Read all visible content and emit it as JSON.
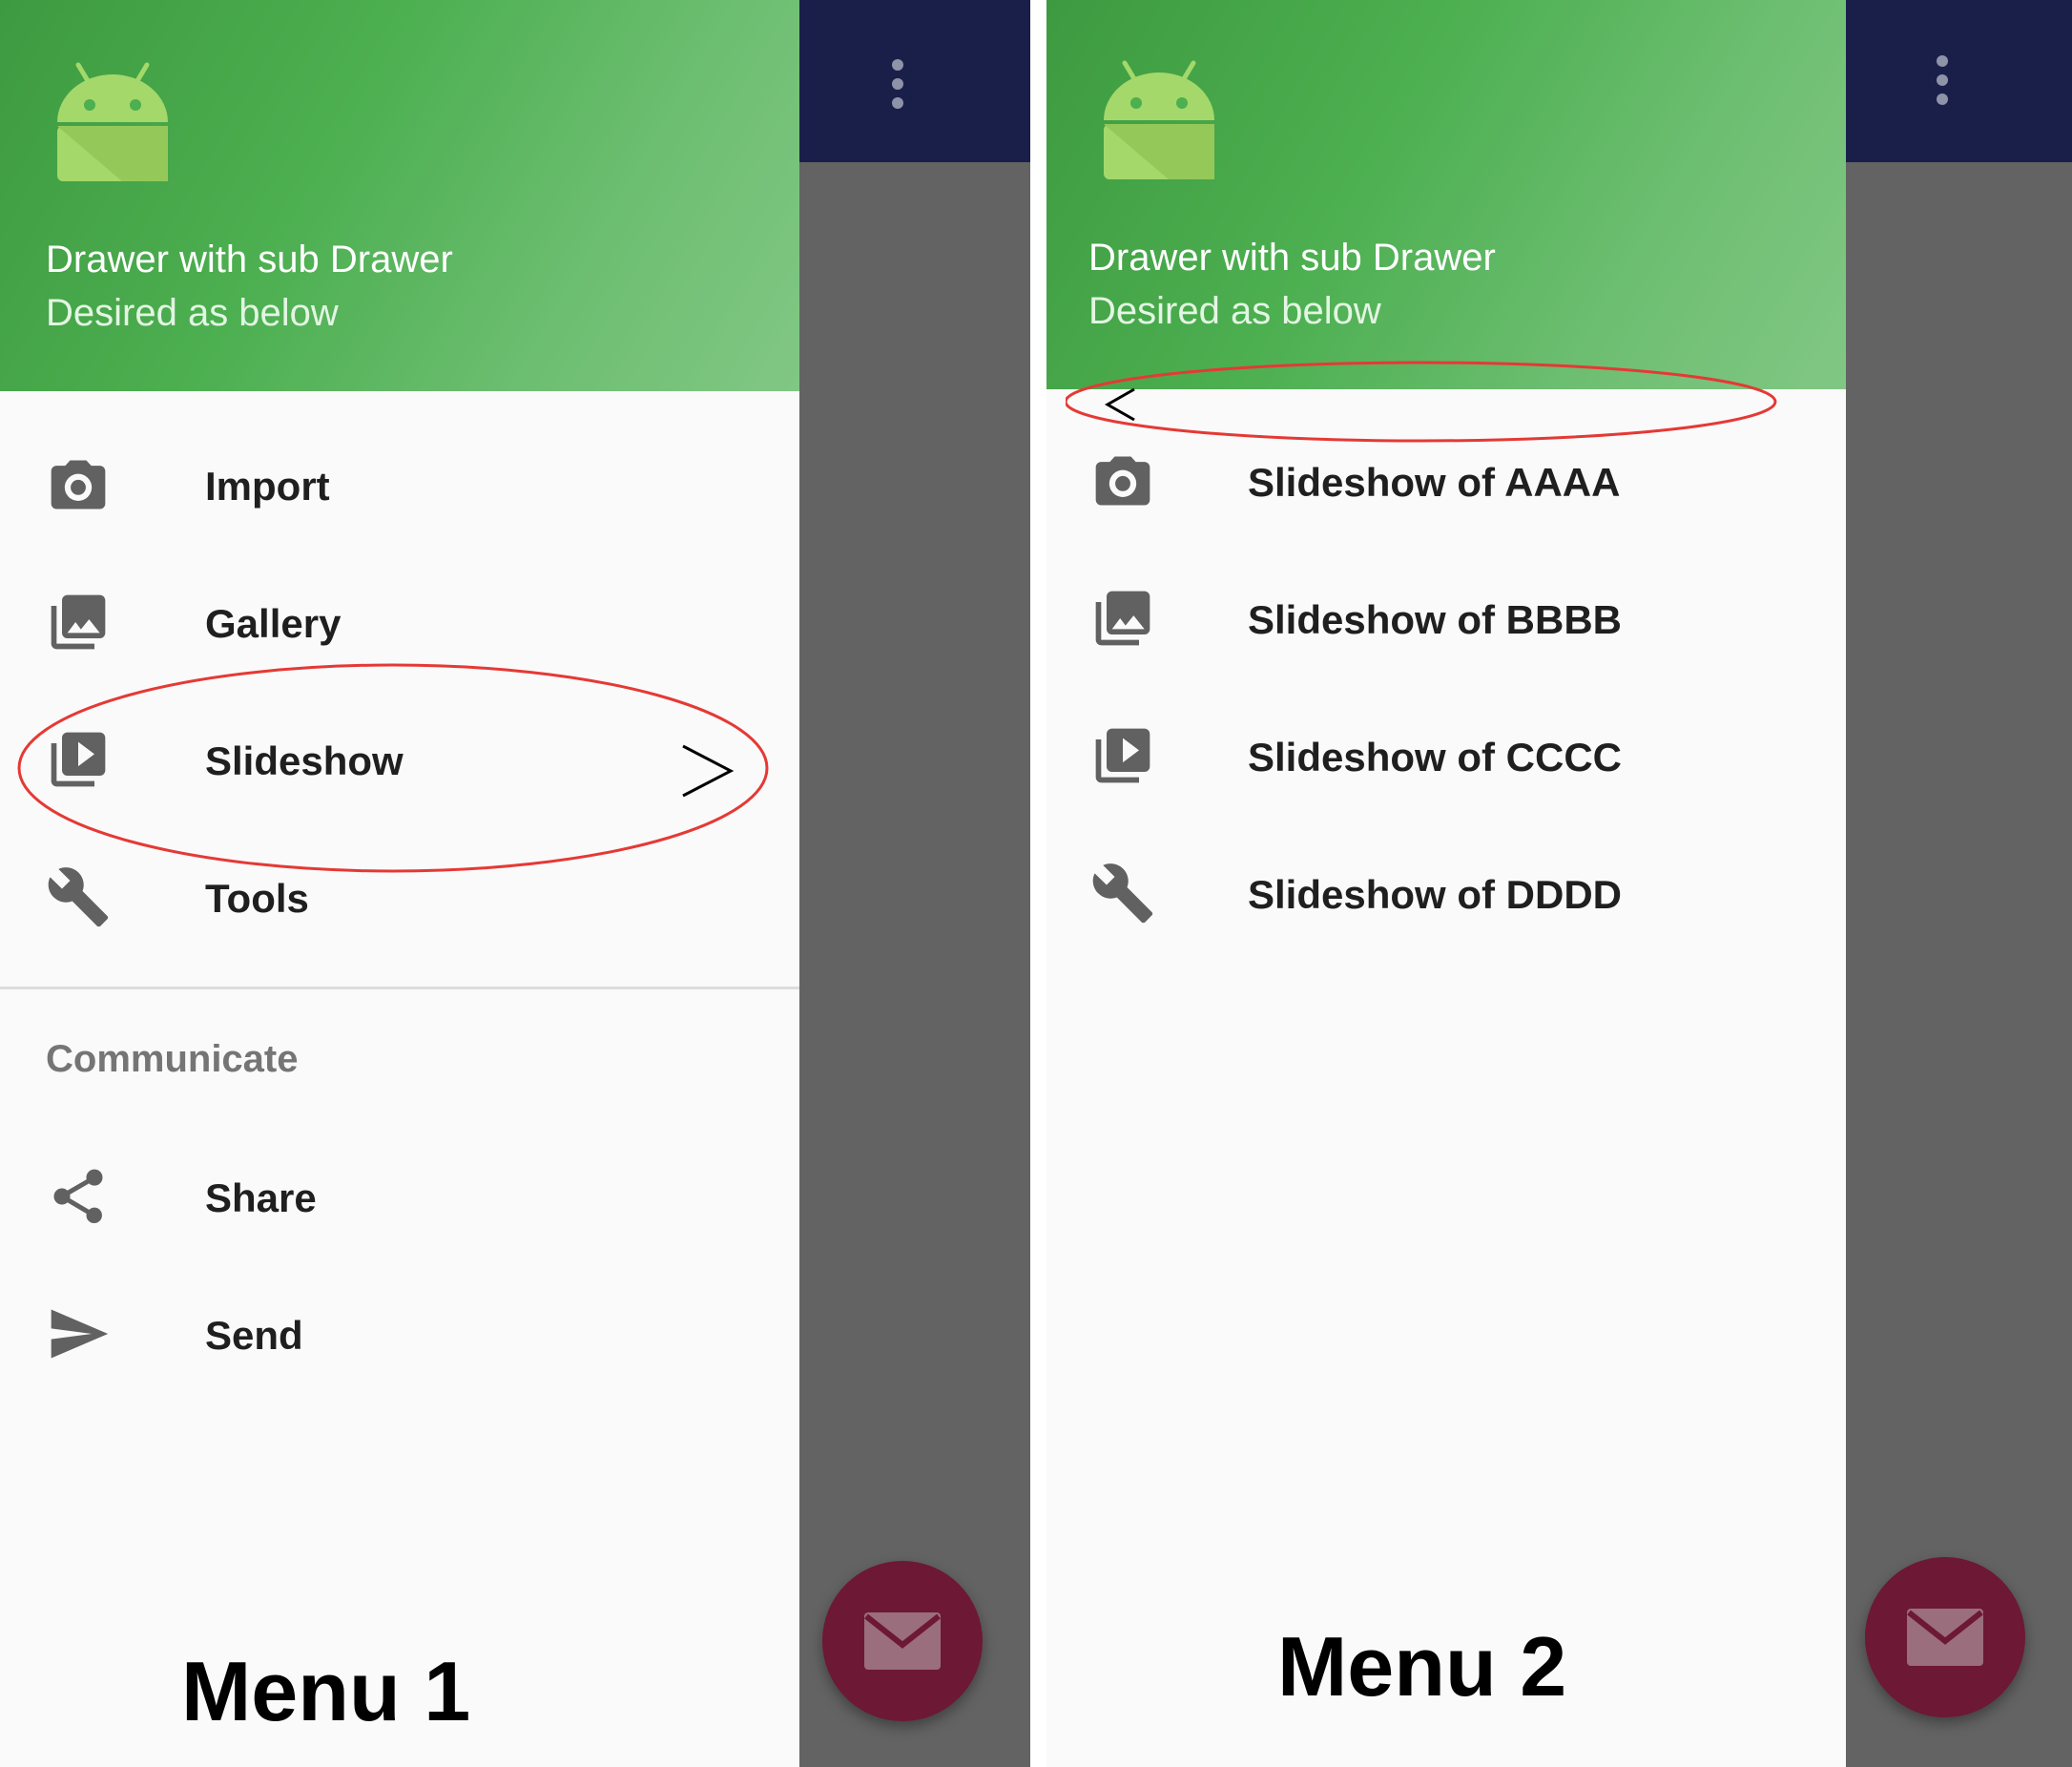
{
  "menu1": {
    "header": {
      "title": "Drawer with sub Drawer",
      "subtitle": "Desired as below"
    },
    "items": [
      {
        "label": "Import",
        "icon": "camera-icon"
      },
      {
        "label": "Gallery",
        "icon": "gallery-icon"
      },
      {
        "label": "Slideshow",
        "icon": "slideshow-icon"
      },
      {
        "label": "Tools",
        "icon": "wrench-icon"
      }
    ],
    "section_label": "Communicate",
    "section_items": [
      {
        "label": "Share",
        "icon": "share-icon"
      },
      {
        "label": "Send",
        "icon": "send-icon"
      }
    ],
    "caption": "Menu 1"
  },
  "menu2": {
    "header": {
      "title": "Drawer with sub Drawer",
      "subtitle": "Desired as below"
    },
    "items": [
      {
        "label": "Slideshow of AAAA",
        "icon": "camera-icon"
      },
      {
        "label": "Slideshow of BBBB",
        "icon": "gallery-icon"
      },
      {
        "label": "Slideshow of CCCC",
        "icon": "slideshow-icon"
      },
      {
        "label": "Slideshow of DDDD",
        "icon": "wrench-icon"
      }
    ],
    "caption": "Menu 2"
  },
  "colors": {
    "header_green": "#4caf50",
    "appbar_navy": "#1a1f4a",
    "scrim_gray": "#636363",
    "fab": "#6d1834",
    "annotation_red": "#e53935"
  }
}
